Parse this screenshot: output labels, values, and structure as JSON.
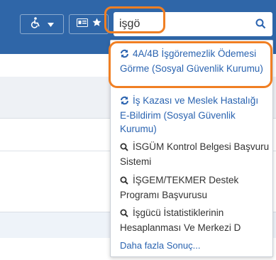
{
  "header": {
    "accessibility_icon": "wheelchair-icon",
    "dropdown_icon": "caret-down-icon",
    "card_icon": "id-card-icon",
    "star_icon": "star-icon"
  },
  "search": {
    "value": "işgö",
    "icon": "search-icon"
  },
  "results": [
    {
      "text": "4A/4B İşgöremezlik Ödemesi Görme (Sosyal Güvenlik Kurumu)",
      "icon": "refresh-icon"
    },
    {
      "text": "İş Kazası ve Meslek Hastalığı E-Bildirim (Sosyal Güvenlik Kurumu)",
      "icon": "refresh-icon"
    },
    {
      "text": "İSGÜM Kontrol Belgesi Başvuru Sistemi",
      "icon": "search-icon"
    },
    {
      "text": "İŞGEM/TEKMER Destek Programı Başvurusu",
      "icon": "search-icon"
    },
    {
      "text": "İşgücü İstatistiklerinin Hesaplanması Ve Merkezi D",
      "icon": "search-icon"
    }
  ],
  "more_results": "Daha fazla Sonuç...",
  "colors": {
    "header_bg": "#2f66a8",
    "highlight": "#f07f23",
    "link": "#2a63b0"
  }
}
